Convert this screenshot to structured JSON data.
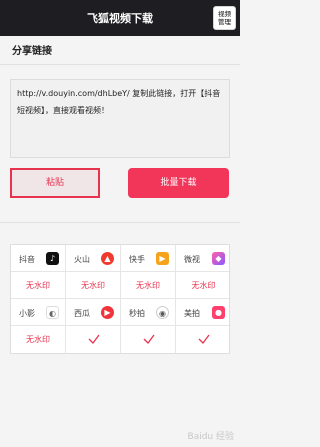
{
  "header": {
    "title": "飞狐视频下载",
    "manage_line1": "视频",
    "manage_line2": "管理"
  },
  "share": {
    "section_title": "分享链接",
    "link_text": "http://v.douyin.com/dhLbeY/ 复制此链接，打开【抖音短视频】，直接观看视频！"
  },
  "actions": {
    "paste_label": "粘贴",
    "batch_label": "批量下载"
  },
  "platforms": [
    {
      "name": "抖音",
      "icon": "douyin-icon",
      "status": "无水印",
      "checked": false
    },
    {
      "name": "火山",
      "icon": "huoshan-icon",
      "status": "无水印",
      "checked": false
    },
    {
      "name": "快手",
      "icon": "kuaishou-icon",
      "status": "无水印",
      "checked": false
    },
    {
      "name": "微视",
      "icon": "weishi-icon",
      "status": "无水印",
      "checked": false
    },
    {
      "name": "小影",
      "icon": "xiaoying-icon",
      "status": "无水印",
      "checked": false
    },
    {
      "name": "西瓜",
      "icon": "xigua-icon",
      "status": "",
      "checked": true
    },
    {
      "name": "秒拍",
      "icon": "miaopai-icon",
      "status": "",
      "checked": true
    },
    {
      "name": "美拍",
      "icon": "meipai-icon",
      "status": "",
      "checked": true
    }
  ],
  "watermark": "Baidu 经验",
  "colors": {
    "accent": "#f2365a",
    "header_bg": "#1e1e22",
    "status_red": "#e8334f"
  }
}
